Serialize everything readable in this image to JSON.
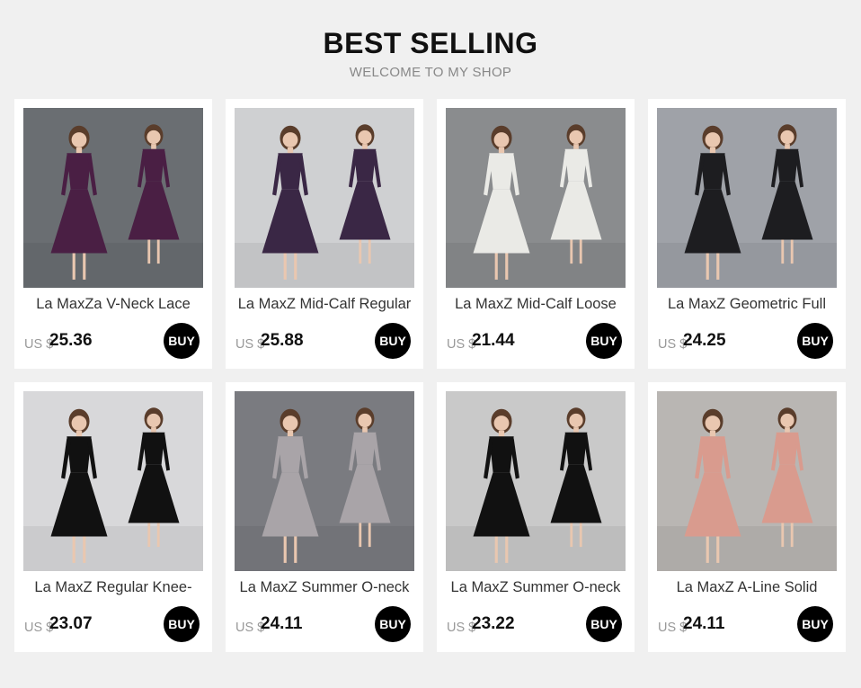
{
  "header": {
    "title": "BEST SELLING",
    "subtitle": "WELCOME TO MY SHOP"
  },
  "colors": {
    "card_bg": "#ffffff",
    "page_bg": "#f0f0f0",
    "buy_bg": "#000000"
  },
  "products": [
    {
      "name": "La MaxZa V-Neck Lace",
      "currency": "US $",
      "price": "25.36",
      "buy_label": "BUY",
      "dress_color": "#4a1f44",
      "bg_color": "#6a6e72"
    },
    {
      "name": "La MaxZ Mid-Calf Regular",
      "currency": "US $",
      "price": "25.88",
      "buy_label": "BUY",
      "dress_color": "#3a2745",
      "bg_color": "#cfd0d2"
    },
    {
      "name": "La MaxZ Mid-Calf Loose",
      "currency": "US $",
      "price": "21.44",
      "buy_label": "BUY",
      "dress_color": "#eaeae6",
      "bg_color": "#8a8c8e"
    },
    {
      "name": "La MaxZ Geometric Full",
      "currency": "US $",
      "price": "24.25",
      "buy_label": "BUY",
      "dress_color": "#1d1d20",
      "bg_color": "#9fa2a8"
    },
    {
      "name": "La MaxZ Regular Knee-",
      "currency": "US $",
      "price": "23.07",
      "buy_label": "BUY",
      "dress_color": "#111111",
      "bg_color": "#d8d8da"
    },
    {
      "name": "La MaxZ Summer O-neck",
      "currency": "US $",
      "price": "24.11",
      "buy_label": "BUY",
      "dress_color": "#a9a4a8",
      "bg_color": "#7a7b80"
    },
    {
      "name": "La MaxZ Summer O-neck",
      "currency": "US $",
      "price": "23.22",
      "buy_label": "BUY",
      "dress_color": "#111111",
      "bg_color": "#c9c9c9"
    },
    {
      "name": "La MaxZ A-Line Solid",
      "currency": "US $",
      "price": "24.11",
      "buy_label": "BUY",
      "dress_color": "#d99b8e",
      "bg_color": "#b9b6b3"
    }
  ]
}
